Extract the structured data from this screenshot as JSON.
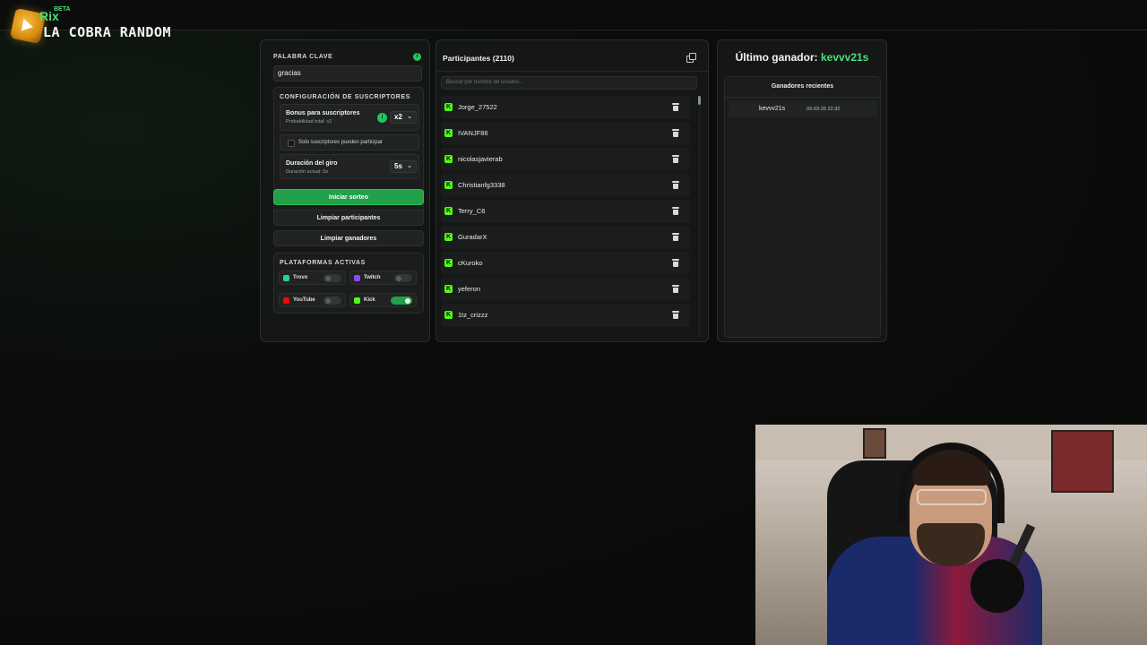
{
  "brand": {
    "name": "Rix",
    "badge": "BETA",
    "subtitle": "LA COBRA RANDOM"
  },
  "keyword": {
    "label": "PALABRA CLAVE",
    "info": "i",
    "value": "gracias"
  },
  "subscribers": {
    "title": "CONFIGURACIÓN DE SUSCRIPTORES",
    "bonus_label": "Bonus para suscriptores",
    "bonus_sub": "Probabilidad total: x2",
    "bonus_info": "i",
    "bonus_value": "x2",
    "only_subs_label": "Solo suscriptores pueden participar",
    "spin_label": "Duración del giro",
    "spin_sub": "Duración actual: 5s",
    "spin_value": "5s"
  },
  "buttons": {
    "start": "Iniciar sorteo",
    "clear_participants": "Limpiar participantes",
    "clear_winners": "Limpiar ganadores"
  },
  "platforms": {
    "title": "PLATAFORMAS ACTIVAS",
    "items": [
      {
        "label": "Trovo",
        "color": "#1fd78b",
        "on": false
      },
      {
        "label": "Twitch",
        "color": "#9146ff",
        "on": false
      },
      {
        "label": "YouTube",
        "color": "#ff0000",
        "on": false
      },
      {
        "label": "Kick",
        "color": "#53fc18",
        "on": true
      }
    ]
  },
  "participants": {
    "title": "Participantes (2110)",
    "search_placeholder": "Buscar por nombre de usuario...",
    "icon_letter": "K",
    "list": [
      "Jorge_27522",
      "IVANJF86",
      "nicolasjavierab",
      "Christianfg3338",
      "Terry_C6",
      "GuradarX",
      "cKuroko",
      "yeferon",
      "1tz_crizzz"
    ]
  },
  "winner": {
    "label": "Último ganador:",
    "name": "kevvv21s",
    "recent_title": "Ganadores recientes",
    "recent": [
      {
        "name": "kevvv21s",
        "date": "03-03-26 22:32"
      }
    ]
  },
  "colors": {
    "accent": "#22a04a",
    "kick": "#53fc18",
    "highlight": "#4ade80"
  }
}
